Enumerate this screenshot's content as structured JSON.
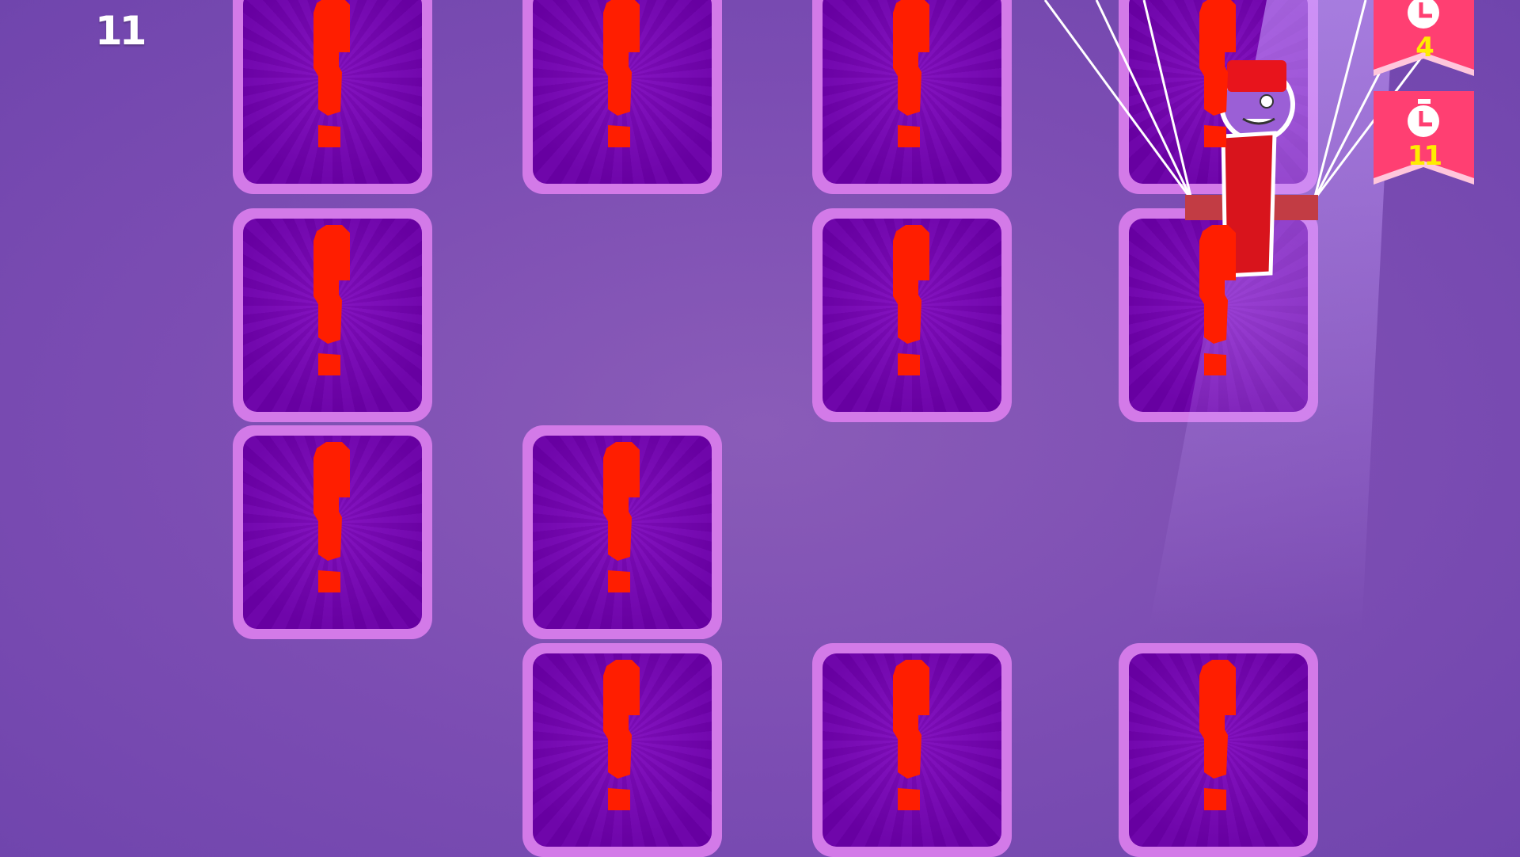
{
  "hud": {
    "score": "11"
  },
  "badges": [
    {
      "icon": "stopwatch-icon",
      "value": "4"
    },
    {
      "icon": "stopwatch-icon",
      "value": "11"
    }
  ],
  "cards": [
    {
      "row": 0,
      "col": 0,
      "face": "exclamation-icon"
    },
    {
      "row": 0,
      "col": 1,
      "face": "exclamation-icon"
    },
    {
      "row": 0,
      "col": 2,
      "face": "exclamation-icon"
    },
    {
      "row": 0,
      "col": 3,
      "face": "exclamation-icon"
    },
    {
      "row": 1,
      "col": 0,
      "face": "exclamation-icon"
    },
    {
      "row": 1,
      "col": 2,
      "face": "exclamation-icon"
    },
    {
      "row": 1,
      "col": 3,
      "face": "exclamation-icon"
    },
    {
      "row": 2,
      "col": 0,
      "face": "exclamation-icon"
    },
    {
      "row": 2,
      "col": 1,
      "face": "exclamation-icon"
    },
    {
      "row": 3,
      "col": 1,
      "face": "exclamation-icon"
    },
    {
      "row": 3,
      "col": 2,
      "face": "exclamation-icon"
    },
    {
      "row": 3,
      "col": 3,
      "face": "exclamation-icon"
    }
  ],
  "colors": {
    "background": "#7c4db3",
    "card_border": "#d37ae8",
    "card_face": "#7600b0",
    "mark": "#ff1e00",
    "badge": "#ff3f72",
    "badge_text": "#ffec00"
  }
}
